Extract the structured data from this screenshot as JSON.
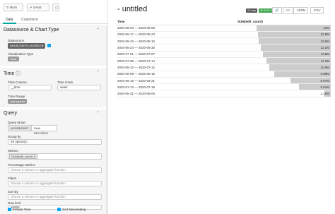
{
  "left": {
    "run_label": "↻ RUN",
    "save_label": "✔ SAVE",
    "tabs": [
      "Data",
      "Customize"
    ],
    "datasource_section": {
      "title": "Datasource & Chart Type",
      "datasource_label": "Datasource",
      "datasource_value": "DRUID.EDITS_HOURLY ▾",
      "viz_label": "Visualization Type",
      "viz_value": "Table"
    },
    "time_section": {
      "title": "Time ⓘ",
      "time_column_label": "Time Column",
      "time_column_value": "__time",
      "time_grain_label": "Time Grain",
      "time_grain_value": "week",
      "time_range_label": "Time Range",
      "time_range_value": "Last quarter"
    },
    "query_section": {
      "title": "Query",
      "mode_label": "Query Mode",
      "mode_options": [
        "AGGREGATE",
        "RAW RECORDS"
      ],
      "group_by_label": "Group by",
      "group_by_value": "29 option(s)",
      "metrics_label": "Metrics",
      "metric_tag": "SUM(edit_count) ✕",
      "pct_metrics_label": "Percentage Metrics",
      "pct_metrics_placeholder": "choose a column or aggregate function",
      "filters_label": "Filters",
      "filters_placeholder": "choose a column or aggregate function",
      "sort_by_label": "Sort By",
      "sort_by_placeholder": "choose a column or aggregate function",
      "row_limit_label": "Row limit",
      "row_limit_value": "10000",
      "include_time_label": "Include Time",
      "sort_desc_label": "Sort Descending"
    }
  },
  "right": {
    "title": "- untitled",
    "badge_rows": "12 rows",
    "badge_time": "00:00:00.21",
    "tools": [
      "🔗",
      "</>",
      ".JSON",
      ".CSV"
    ],
    "table": {
      "headers": [
        "Time",
        "SUM(edit_count)"
      ],
      "rows": [
        {
          "time": "2020-06-03 — 2020-06-09",
          "value": "13M",
          "fraction": 1.0
        },
        {
          "time": "2020-06-17 — 2020-06-23",
          "value": "12.8M",
          "fraction": 0.985
        },
        {
          "time": "2020-06-10 — 2020-06-16",
          "value": "12.6M",
          "fraction": 0.97
        },
        {
          "time": "2020-06-24 — 2020-06-30",
          "value": "12.2M",
          "fraction": 0.94
        },
        {
          "time": "2020-07-01 — 2020-07-07",
          "value": "11.8M",
          "fraction": 0.91
        },
        {
          "time": "2020-07-08 — 2020-07-14",
          "value": "11.3M",
          "fraction": 0.87
        },
        {
          "time": "2020-06-10 — 2020-07-12",
          "value": "10.8M",
          "fraction": 0.83
        },
        {
          "time": "2020-06-09 — 2020-06-15",
          "value": "9.88M",
          "fraction": 0.76
        },
        {
          "time": "2020-06-16 — 2020-06-21",
          "value": "6.97M",
          "fraction": 0.54
        },
        {
          "time": "2020-07-13 — 2020-07-19",
          "value": "5.61M",
          "fraction": 0.43
        },
        {
          "time": "2020-06-31 — 2020-06-06",
          "value": "1.15M",
          "fraction": 0.09
        }
      ]
    }
  }
}
